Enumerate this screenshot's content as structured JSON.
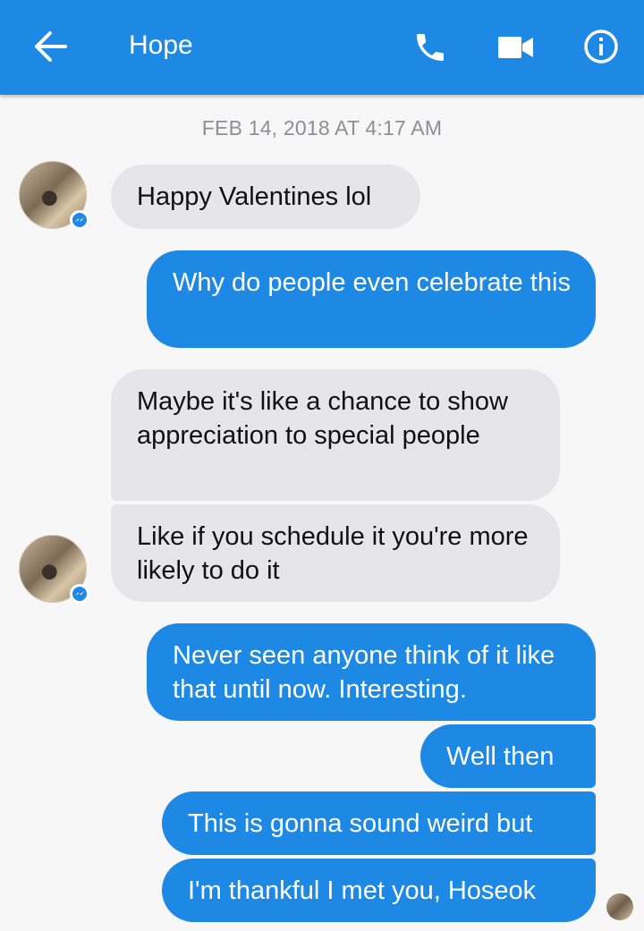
{
  "header": {
    "contact_name": "Hope",
    "icons": [
      "back-arrow-icon",
      "phone-icon",
      "video-camera-icon",
      "info-icon"
    ]
  },
  "conversation": {
    "timestamp": "FEB 14, 2018 AT 4:17 AM",
    "messages": [
      {
        "from": "Hope",
        "text": "Happy Valentines lol"
      },
      {
        "from": "me",
        "text": "Why do people even celebrate this"
      },
      {
        "from": "Hope",
        "text": "Maybe it's like a chance to show appreciation to special people"
      },
      {
        "from": "Hope",
        "text": "Like if you schedule it you're more likely to do it"
      },
      {
        "from": "me",
        "text": "Never seen anyone think of it like that until now. Interesting."
      },
      {
        "from": "me",
        "text": "Well then"
      },
      {
        "from": "me",
        "text": "This is gonna sound weird but"
      },
      {
        "from": "me",
        "text": "I'm thankful I met you, Hoseok"
      }
    ]
  },
  "colors": {
    "accent": "#1e88e5",
    "incoming_bubble": "#e6e6e8",
    "background": "#f7f7f8"
  }
}
